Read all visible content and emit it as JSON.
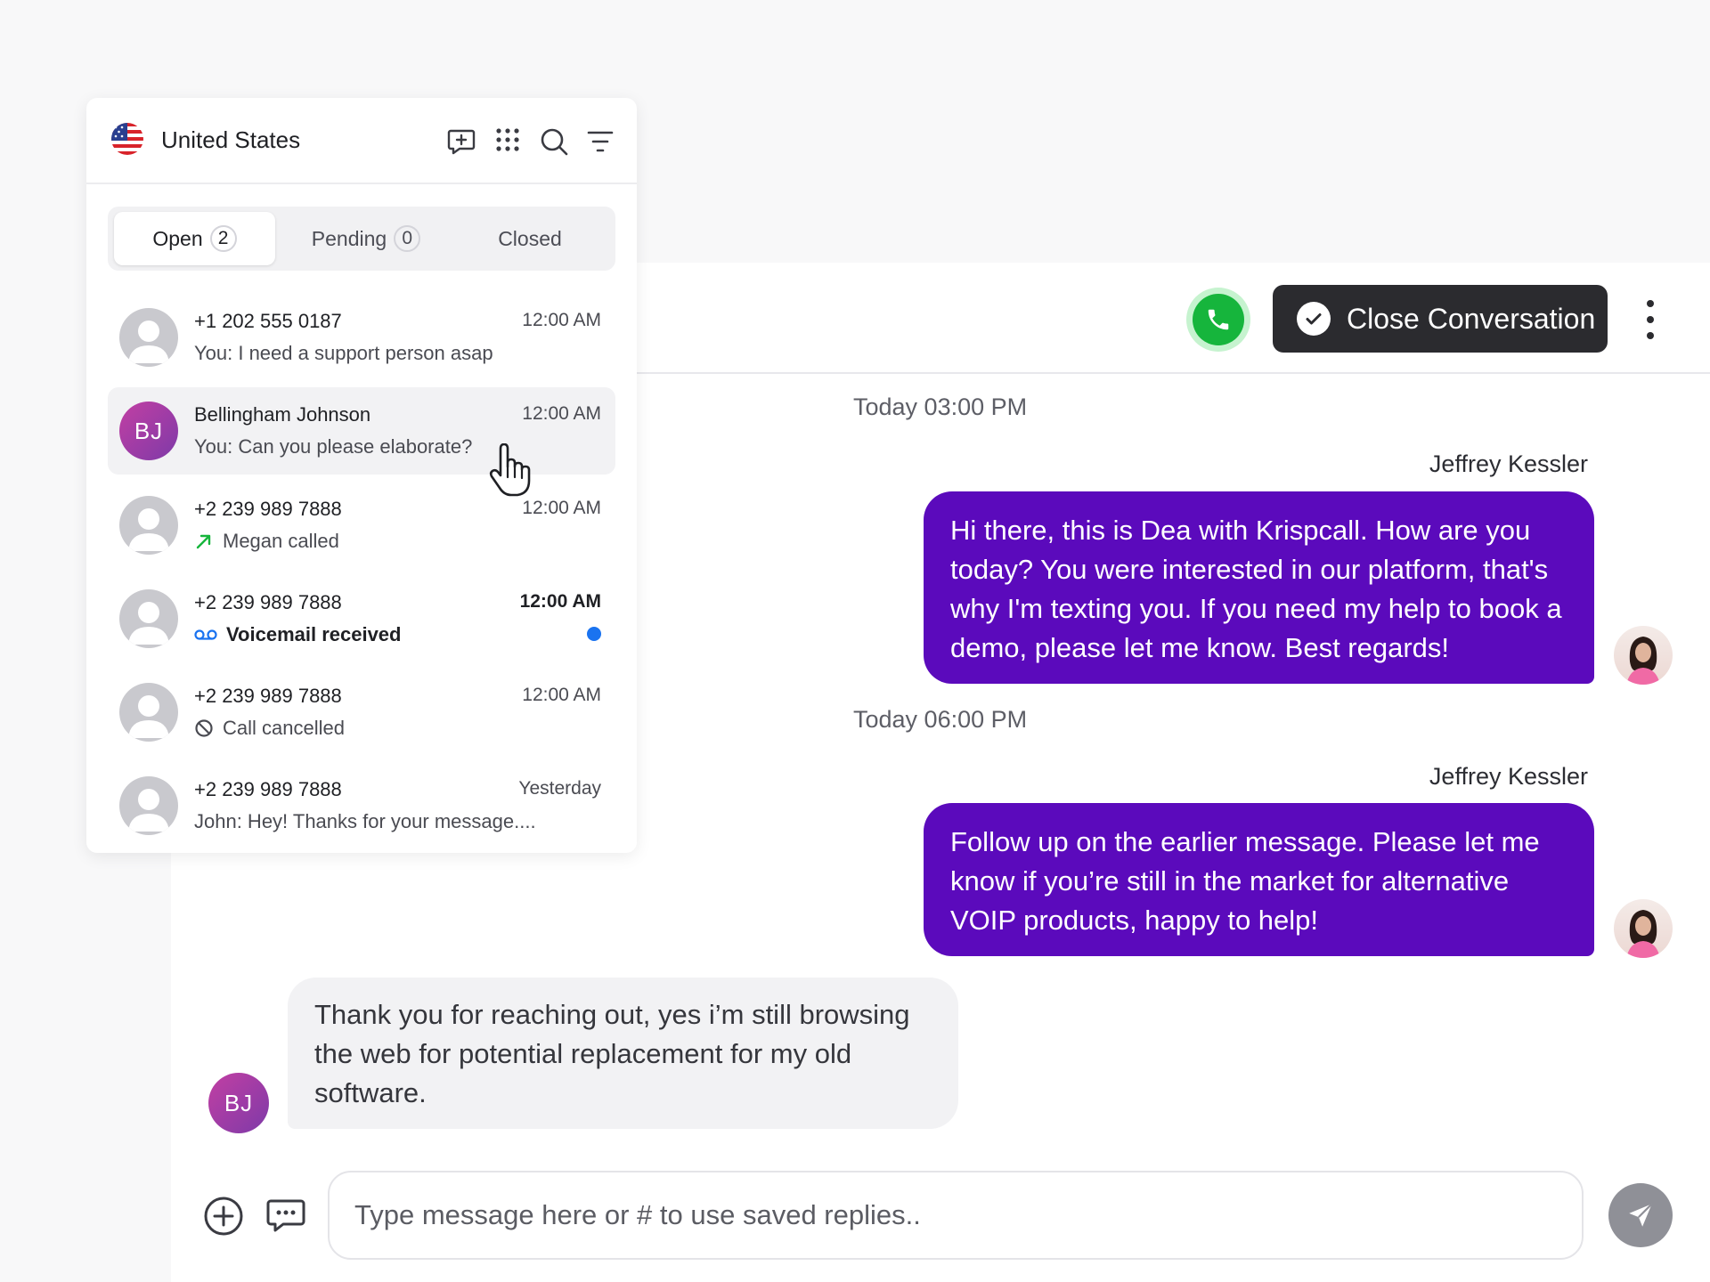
{
  "header": {
    "country": "United States",
    "icons": [
      "new-message-icon",
      "dialpad-icon",
      "search-icon",
      "filter-icon"
    ]
  },
  "tabs": [
    {
      "label": "Open",
      "count": "2"
    },
    {
      "label": "Pending",
      "count": "0"
    },
    {
      "label": "Closed"
    }
  ],
  "conversations": [
    {
      "name": "+1 202 555 0187",
      "preview": "You: I need a support person asap",
      "time": "12:00 AM"
    },
    {
      "name": "Bellingham Johnson",
      "initials": "BJ",
      "preview": "You: Can you please elaborate?",
      "time": "12:00 AM"
    },
    {
      "name": "+2 239 989 7888",
      "preview": "Megan called",
      "time": "12:00 AM"
    },
    {
      "name": "+2 239 989 7888",
      "preview": "Voicemail received",
      "time": "12:00 AM"
    },
    {
      "name": "+2 239 989 7888",
      "preview": "Call cancelled",
      "time": "12:00 AM"
    },
    {
      "name": "+2 239 989 7888",
      "preview": "John: Hey! Thanks for your message....",
      "time": "Yesterday"
    }
  ],
  "chat": {
    "close_label": "Close Conversation",
    "messages": [
      {
        "timestamp": "Today 03:00 PM",
        "sender": "Jeffrey Kessler",
        "text": "Hi there, this is Dea with Krispcall. How are you today? You were interested in our platform, that's why I'm texting you. If you need my help to book a demo, please let me know. Best regards!"
      },
      {
        "timestamp": "Today 06:00 PM",
        "sender": "Jeffrey Kessler",
        "text": "Follow up on the earlier message. Please let me know if you’re still in the market for alternative VOIP products, happy to help!"
      }
    ],
    "reply": {
      "initials": "BJ",
      "text": "Thank you for reaching out, yes i’m still browsing the web for potential replacement for my old software."
    },
    "input_placeholder": "Type message here or # to use saved replies.."
  },
  "colors": {
    "accent": "#5b0abc",
    "call": "#16b53c",
    "dark": "#2b2b2f",
    "unread": "#1a73f0"
  }
}
